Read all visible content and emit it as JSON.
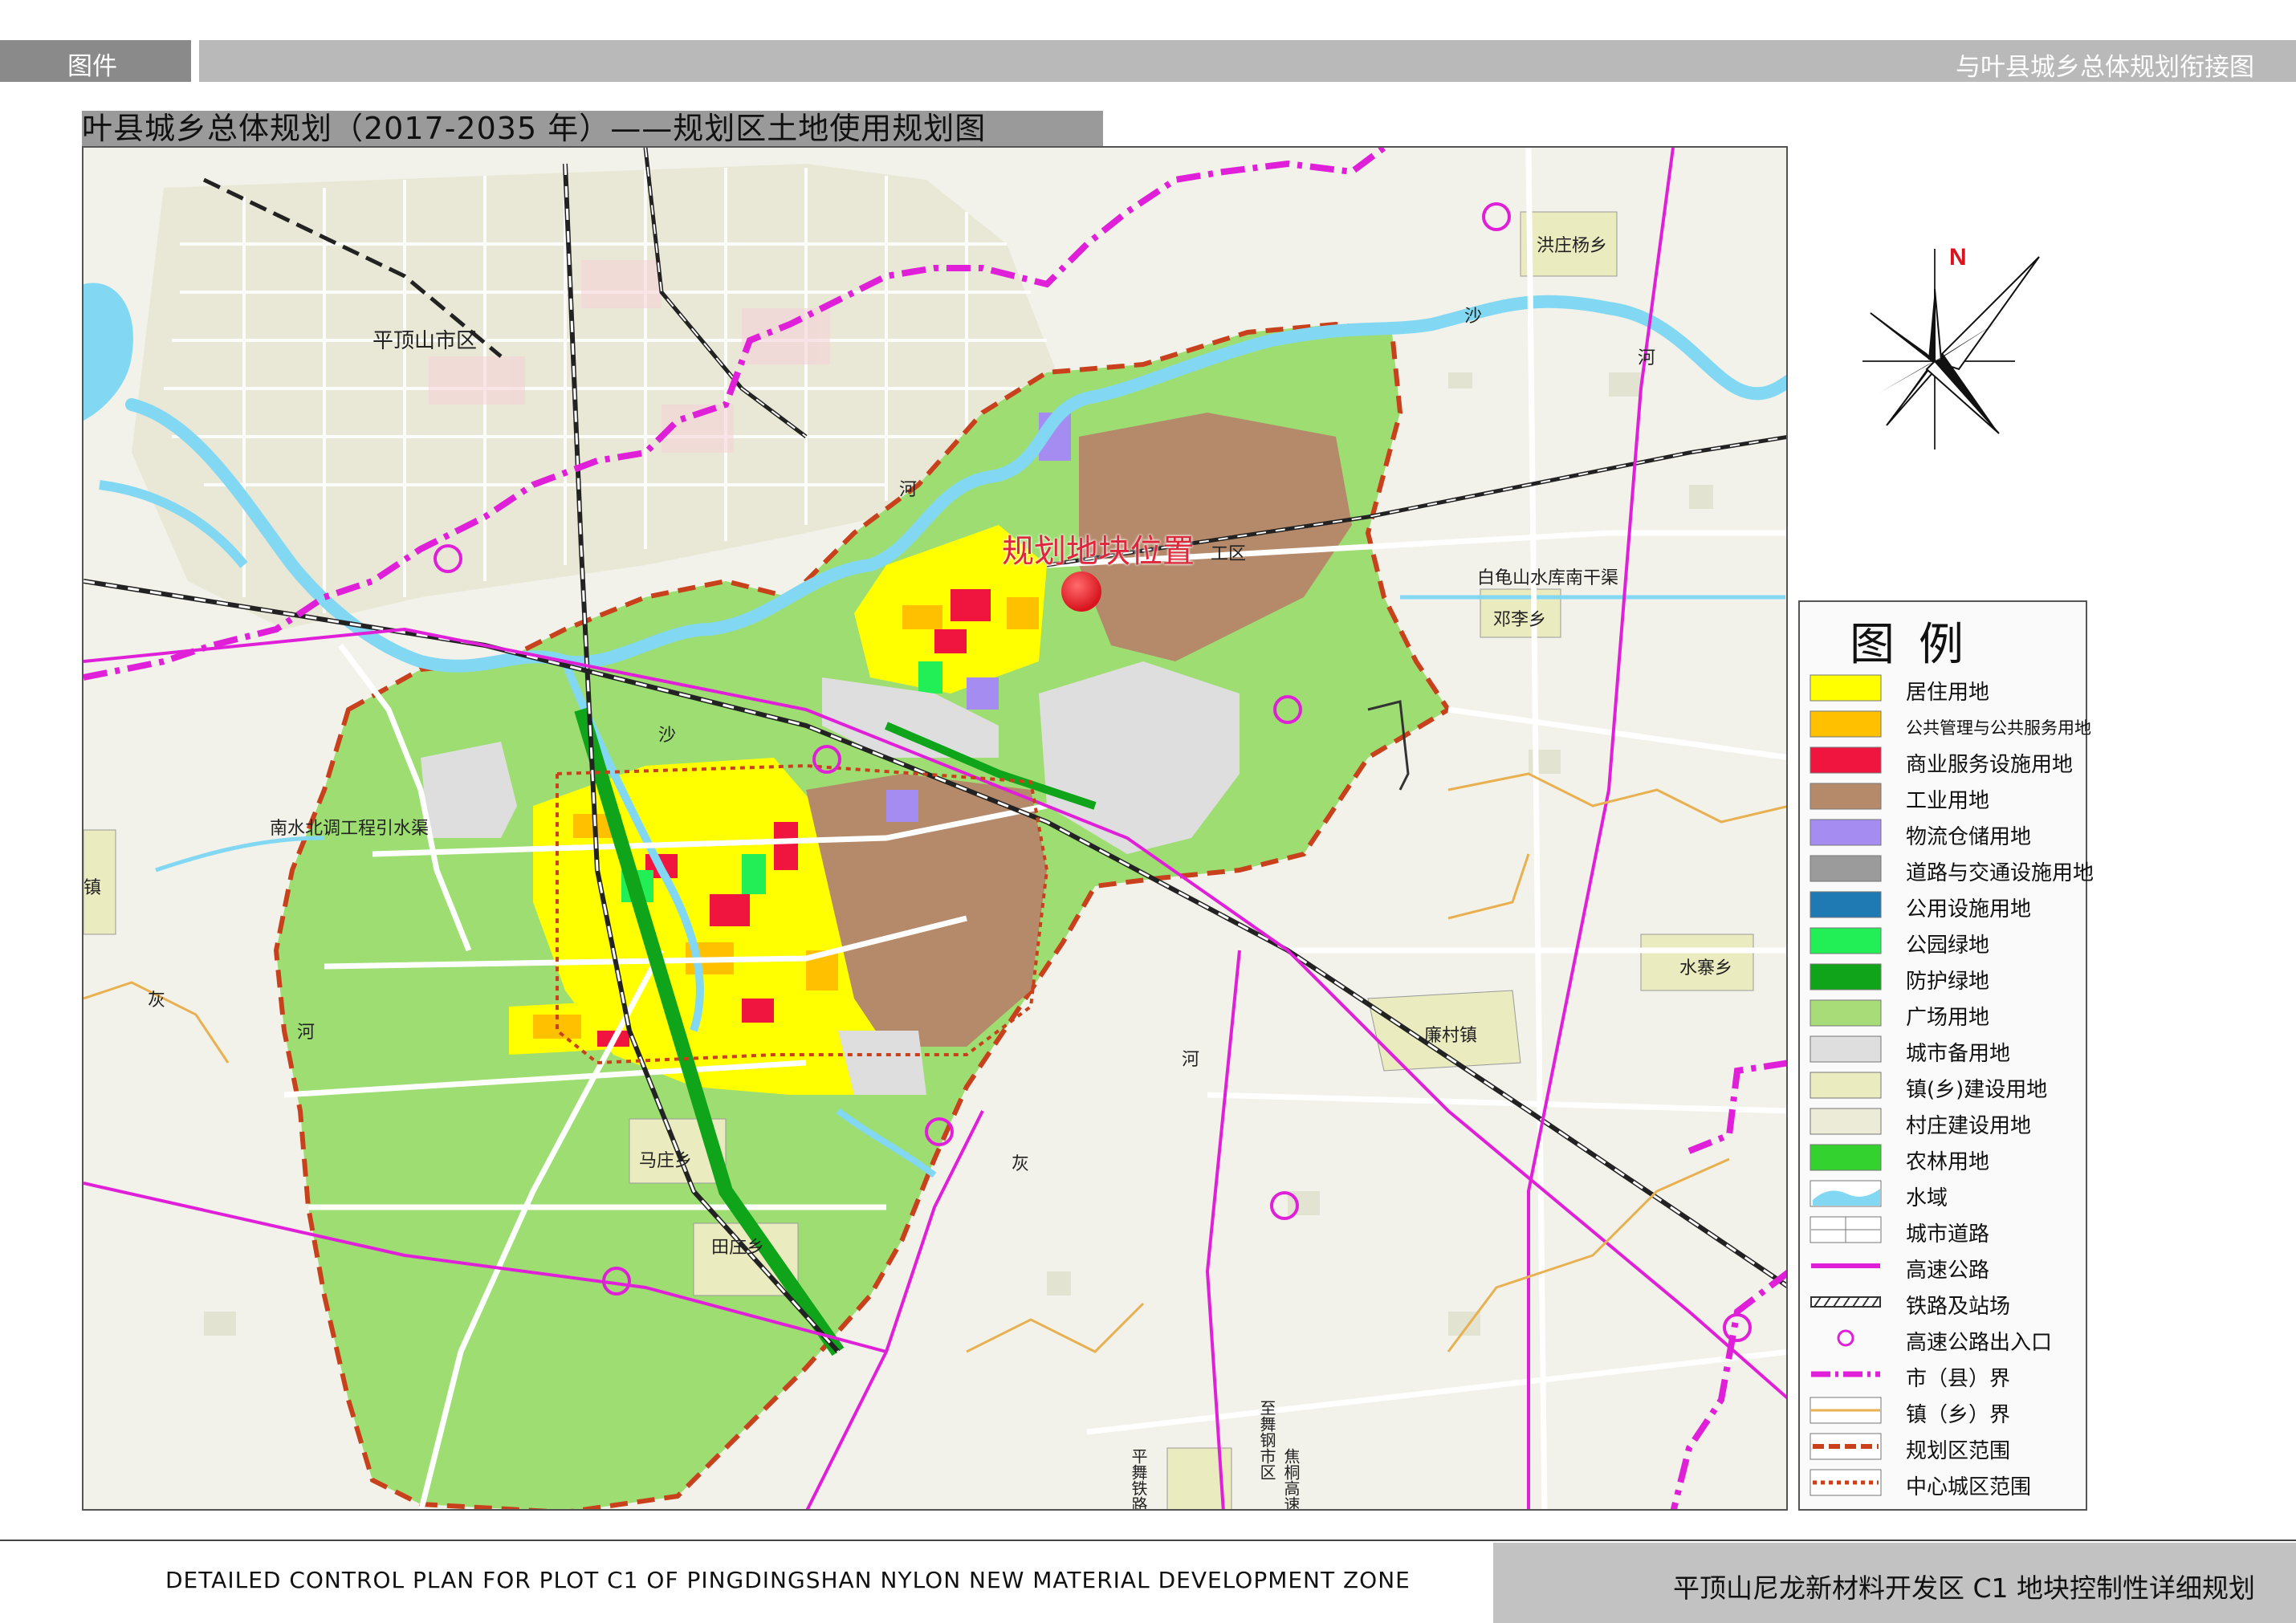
{
  "header": {
    "tag": "图件",
    "right_title": "与叶县城乡总体规划衔接图"
  },
  "map": {
    "title": "叶县城乡总体规划（2017-2035 年）——规划区土地使用规划图",
    "site_label": "规划地块位置",
    "north_label": "N",
    "place_labels": {
      "pingdingshan": "平顶山市区",
      "hongzhuangyang": "洪庄杨乡",
      "dengli": "邓李乡",
      "shuizhai": "水寨乡",
      "liancun": "廉村镇",
      "mazhuang": "马庄乡",
      "tianzhuang": "田庄乡",
      "baiguishan": "白龟山水库南干渠",
      "nanshuibeidiao": "南水北调工程引水渠",
      "gongqu": "工区",
      "zhen": "镇",
      "sha_1": "沙",
      "sha_2": "沙",
      "he_1": "河",
      "he_2": "河",
      "he_3": "河",
      "hui_1": "灰",
      "hui_2": "灰",
      "he_4": "河",
      "pingwu_rail": "平舞铁路",
      "zhiwu_rail": "至舞钢市区",
      "jiaotong_hwy": "焦桐高速"
    },
    "colors": {
      "residential": "#ffff00",
      "public": "#ffc000",
      "commercial": "#f0153f",
      "industrial": "#b48a6a",
      "logistics": "#a58cf0",
      "road": "#9b9b9b",
      "utility": "#1f7ab3",
      "park": "#22ee55",
      "protective": "#0fa41a",
      "square": "#a8dc78",
      "reserve": "#dedede",
      "town": "#ebebc0",
      "village": "#ebebd8",
      "agri": "#34d22e",
      "water": "#82d8f2",
      "highway": "#e020d8",
      "boundary_red": "#c8401c"
    }
  },
  "legend": {
    "title": "图例",
    "items": [
      {
        "label": "居住用地",
        "color": "#ffff00",
        "kind": "fill"
      },
      {
        "label": "公共管理与公共服务用地",
        "color": "#ffc000",
        "kind": "fill",
        "small": true
      },
      {
        "label": "商业服务设施用地",
        "color": "#f0153f",
        "kind": "fill"
      },
      {
        "label": "工业用地",
        "color": "#b48a6a",
        "kind": "fill"
      },
      {
        "label": "物流仓储用地",
        "color": "#a58cf0",
        "kind": "fill"
      },
      {
        "label": "道路与交通设施用地",
        "color": "#9b9b9b",
        "kind": "fill"
      },
      {
        "label": "公用设施用地",
        "color": "#1f7ab3",
        "kind": "fill"
      },
      {
        "label": "公园绿地",
        "color": "#22ee55",
        "kind": "fill"
      },
      {
        "label": "防护绿地",
        "color": "#0fa41a",
        "kind": "fill"
      },
      {
        "label": "广场用地",
        "color": "#a8dc78",
        "kind": "fill"
      },
      {
        "label": "城市备用地",
        "color": "#dedede",
        "kind": "fill"
      },
      {
        "label": "镇(乡)建设用地",
        "color": "#ebebc0",
        "kind": "fill"
      },
      {
        "label": "村庄建设用地",
        "color": "#ebebd8",
        "kind": "fill"
      },
      {
        "label": "农林用地",
        "color": "#34d22e",
        "kind": "fill"
      },
      {
        "label": "水域",
        "color": "#82d8f2",
        "kind": "water"
      },
      {
        "label": "城市道路",
        "color": "#ffffff",
        "kind": "road"
      },
      {
        "label": "高速公路",
        "color": "#e020d8",
        "kind": "highway"
      },
      {
        "label": "铁路及站场",
        "color": "#333333",
        "kind": "rail"
      },
      {
        "label": "高速公路出入口",
        "color": "#e020d8",
        "kind": "circle"
      },
      {
        "label": "市（县）界",
        "color": "#e020d8",
        "kind": "dashdot"
      },
      {
        "label": "镇（乡）界",
        "color": "#e8b050",
        "kind": "town-line"
      },
      {
        "label": "规划区范围",
        "color": "#c8401c",
        "kind": "dashed"
      },
      {
        "label": "中心城区范围",
        "color": "#c8401c",
        "kind": "dotted"
      }
    ]
  },
  "footer": {
    "left": "DETAILED CONTROL PLAN FOR PLOT C1 OF PINGDINGSHAN NYLON NEW MATERIAL DEVELOPMENT ZONE",
    "right": "平顶山尼龙新材料开发区 C1 地块控制性详细规划"
  }
}
